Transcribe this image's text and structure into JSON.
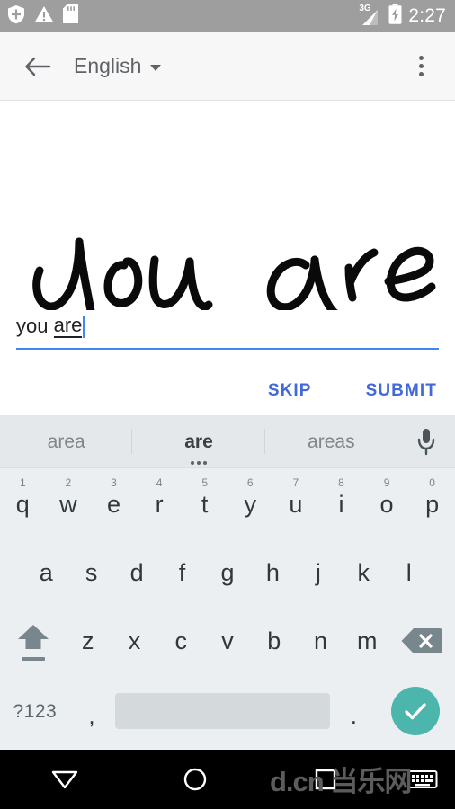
{
  "status_bar": {
    "icons_left": [
      "shield-icon",
      "warning-icon",
      "sd-card-icon"
    ],
    "network_label": "3G",
    "battery": "charging",
    "time": "2:27",
    "bg_color": "#9e9e9e"
  },
  "app_bar": {
    "back_label": "back-arrow",
    "title": "English",
    "has_dropdown": true,
    "overflow_label": "more-options"
  },
  "canvas": {
    "handwriting_text": "you are",
    "ink_color": "#0a0a0a",
    "background": "#ffffff"
  },
  "input": {
    "committed_text": "you ",
    "composing_text": "are",
    "full_value": "you are",
    "placeholder": "",
    "underline_color": "#4285f4",
    "caret_color": "#4285f4"
  },
  "actions": {
    "skip_label": "SKIP",
    "submit_label": "SUBMIT",
    "color": "#4169d8"
  },
  "keyboard": {
    "suggestions": [
      {
        "text": "area",
        "selected": false
      },
      {
        "text": "are",
        "selected": true
      },
      {
        "text": "areas",
        "selected": false
      }
    ],
    "mic_label": "voice-input",
    "row1": [
      {
        "key": "q",
        "hint": "1"
      },
      {
        "key": "w",
        "hint": "2"
      },
      {
        "key": "e",
        "hint": "3"
      },
      {
        "key": "r",
        "hint": "4"
      },
      {
        "key": "t",
        "hint": "5"
      },
      {
        "key": "y",
        "hint": "6"
      },
      {
        "key": "u",
        "hint": "7"
      },
      {
        "key": "i",
        "hint": "8"
      },
      {
        "key": "o",
        "hint": "9"
      },
      {
        "key": "p",
        "hint": "0"
      }
    ],
    "row2": [
      {
        "key": "a"
      },
      {
        "key": "s"
      },
      {
        "key": "d"
      },
      {
        "key": "f"
      },
      {
        "key": "g"
      },
      {
        "key": "h"
      },
      {
        "key": "j"
      },
      {
        "key": "k"
      },
      {
        "key": "l"
      }
    ],
    "row3": [
      {
        "key": "z"
      },
      {
        "key": "x"
      },
      {
        "key": "c"
      },
      {
        "key": "v"
      },
      {
        "key": "b"
      },
      {
        "key": "n"
      },
      {
        "key": "m"
      }
    ],
    "shift_label": "shift",
    "backspace_label": "backspace",
    "symbols_label": "?123",
    "comma_label": ",",
    "space_label": "",
    "period_label": ".",
    "enter_label": "enter-check",
    "enter_color": "#4db6ac",
    "bg_color": "#eceff1",
    "suggestion_bg": "#e4e8ea"
  },
  "nav_bar": {
    "back_label": "nav-back",
    "home_label": "nav-home",
    "recents_label": "nav-recents",
    "keyboard_switch_label": "keyboard-switcher",
    "watermark": "d.cn 当乐网"
  }
}
